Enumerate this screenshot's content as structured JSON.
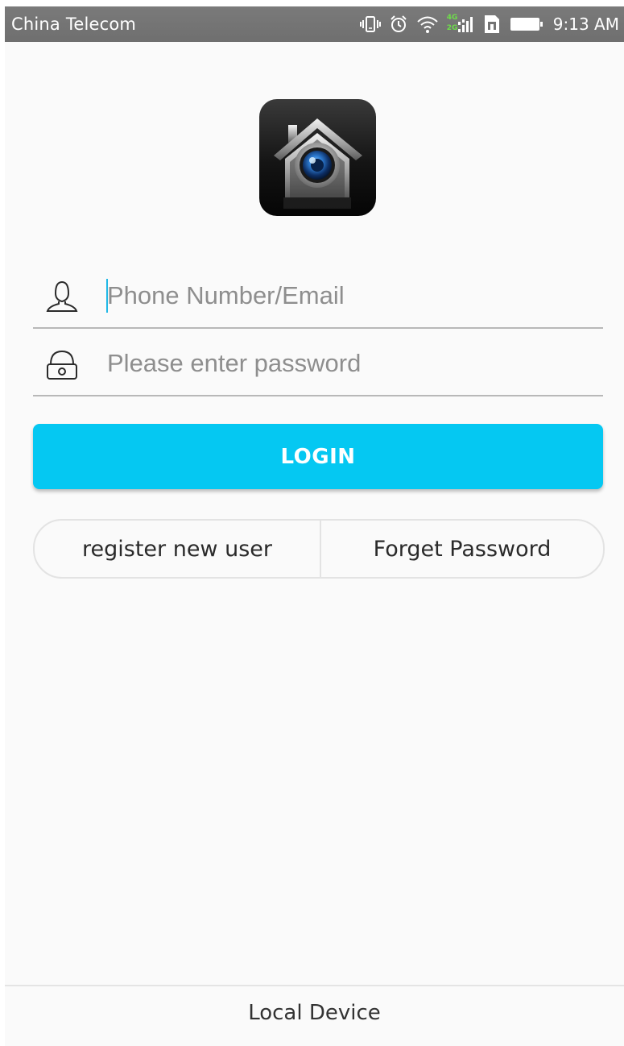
{
  "status_bar": {
    "carrier": "China Telecom",
    "time": "9:13 AM",
    "network_top": "4G",
    "network_bottom": "2G",
    "icons": [
      "vibrate-icon",
      "alarm-icon",
      "wifi-icon",
      "cell-signal-icon",
      "sim-icon",
      "battery-icon"
    ]
  },
  "logo": {
    "icon": "home-camera-app-icon"
  },
  "login_form": {
    "username": {
      "icon": "user-icon",
      "placeholder": "Phone Number/Email",
      "value": ""
    },
    "password": {
      "icon": "lock-icon",
      "placeholder": "Please enter password",
      "value": ""
    },
    "login_label": "LOGIN"
  },
  "secondary_actions": {
    "register_label": "register new user",
    "forgot_label": "Forget Password"
  },
  "footer": {
    "local_device_label": "Local Device"
  },
  "colors": {
    "accent": "#05c8f2",
    "status_bar": "#737373",
    "background": "#fafafa"
  }
}
